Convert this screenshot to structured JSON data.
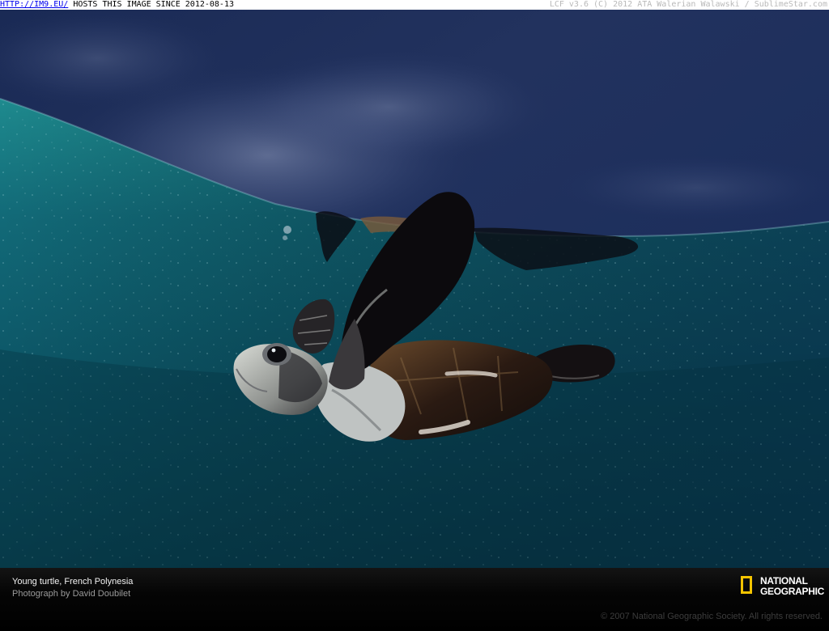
{
  "banner": {
    "link_text": "HTTP://IM9.EU/",
    "host_text": " HOSTS THIS IMAGE SINCE 2012-08-13",
    "right_text": "LCF v3.6 (C) 2012 ATA Walerian Walawski / SublimeStar.com"
  },
  "caption": {
    "title": "Young turtle, French Polynesia",
    "credit": "Photograph by David Doubilet",
    "copyright": "© 2007 National Geographic Society. All rights reserved."
  },
  "logo": {
    "line1": "NATIONAL",
    "line2": "GEOGRAPHIC",
    "frame_color": "#f4c400"
  },
  "photo": {
    "subject": "sea-turtle-hatchling-underwater",
    "colors": {
      "sky": "#1b2c55",
      "water": "#0f5a6a",
      "deep_water": "#073a48"
    }
  }
}
